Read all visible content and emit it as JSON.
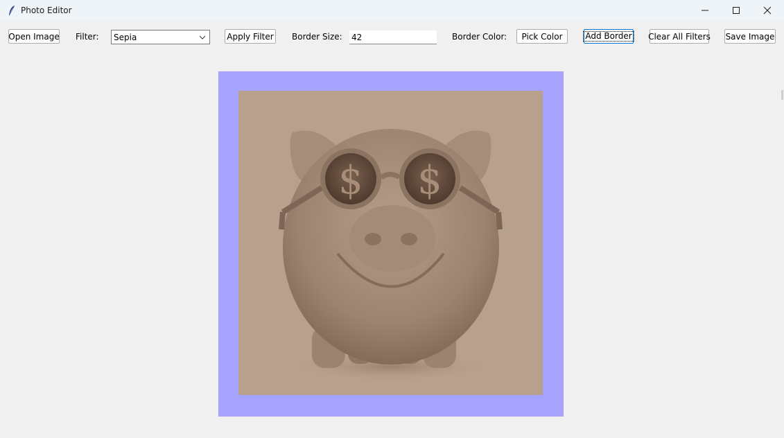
{
  "window": {
    "title": "Photo Editor",
    "icon": "feather-icon"
  },
  "toolbar": {
    "open_image_label": "Open Image",
    "filter_label": "Filter:",
    "filter_selected": "Sepia",
    "apply_filter_label": "Apply Filter",
    "border_size_label": "Border Size:",
    "border_size_value": "42",
    "border_color_label": "Border Color:",
    "pick_color_label": "Pick Color",
    "add_border_label": "Add Border",
    "clear_filters_label": "Clear All Filters",
    "save_image_label": "Save Image"
  },
  "canvas": {
    "border_color": "#a5a3fe",
    "image_tint": "#b7a08c",
    "image_subject": "piggy bank with dollar-sign glasses"
  }
}
